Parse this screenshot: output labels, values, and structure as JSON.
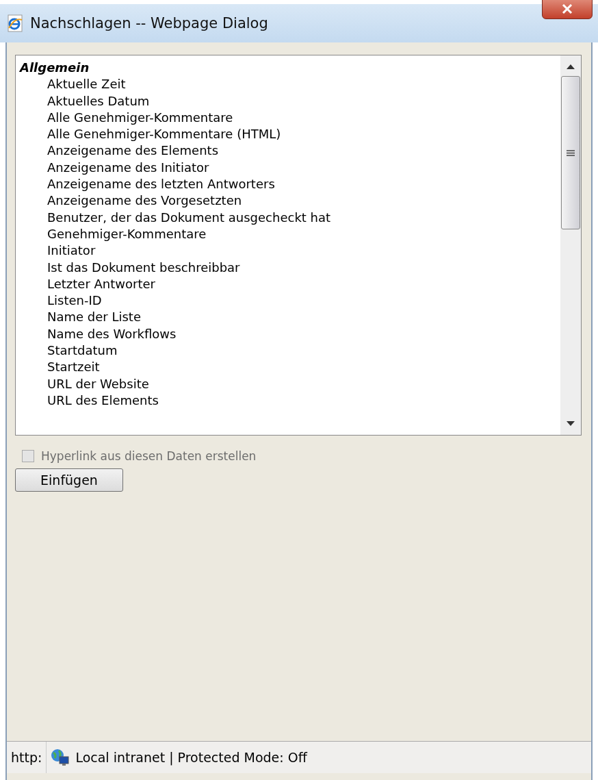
{
  "window": {
    "title": "Nachschlagen -- Webpage Dialog"
  },
  "list": {
    "group": "Allgemein",
    "items": [
      "Aktuelle Zeit",
      "Aktuelles Datum",
      "Alle Genehmiger-Kommentare",
      "Alle Genehmiger-Kommentare (HTML)",
      "Anzeigename des Elements",
      "Anzeigename des Initiator",
      "Anzeigename des letzten Antworters",
      "Anzeigename des Vorgesetzten",
      "Benutzer, der das Dokument ausgecheckt hat",
      "Genehmiger-Kommentare",
      "Initiator",
      "Ist das Dokument beschreibbar",
      "Letzter Antworter",
      "Listen-ID",
      "Name der Liste",
      "Name des Workflows",
      "Startdatum",
      "Startzeit",
      "URL der Website",
      "URL des Elements"
    ]
  },
  "checkbox": {
    "label": "Hyperlink aus diesen Daten erstellen",
    "checked": false,
    "disabled": true
  },
  "button": {
    "label": "Einfügen"
  },
  "status_bar": {
    "protocol": "http:",
    "zone": "Local intranet | Protected Mode: Off"
  }
}
